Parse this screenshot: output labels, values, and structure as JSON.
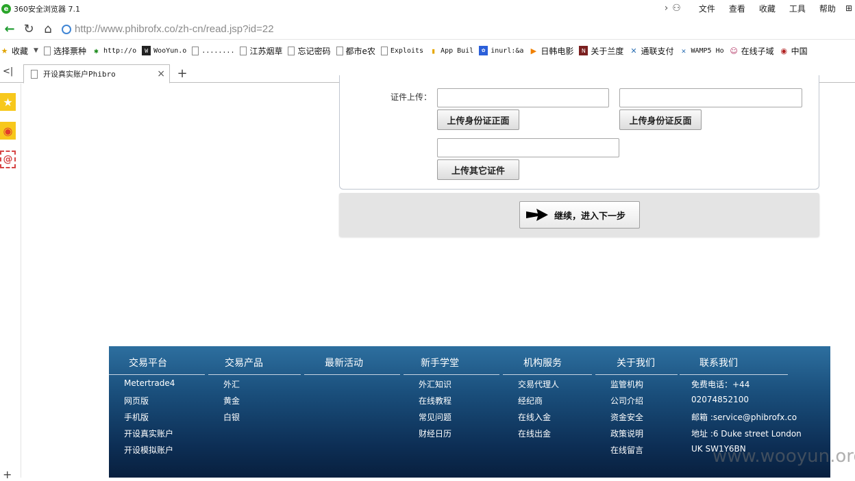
{
  "browser": {
    "app_title": "360安全浏览器 7.1",
    "menus": [
      "文件",
      "查看",
      "收藏",
      "工具",
      "帮助"
    ],
    "url": "http://www.phibrofx.co/zh-cn/read.jsp?id=22",
    "tab_title": "开设真实账户Phibro",
    "bookmarks": {
      "favorites": "收藏",
      "b1": "选择票种",
      "b2": "http://o",
      "b3": "WooYun.o",
      "b4": "........",
      "b5": "江苏烟草",
      "b6": "忘记密码",
      "b7": "都市e农",
      "b8": "Exploits",
      "b9": "App Buil",
      "b10": "inurl:&a",
      "b11": "日韩电影",
      "b12": "关于兰度",
      "b13": "通联支付",
      "b14": "WAMP5 Ho",
      "b15": "在线子域",
      "b16": "中国"
    }
  },
  "form": {
    "upload_label": "证件上传：",
    "btn_front": "上传身份证正面",
    "btn_back": "上传身份证反面",
    "btn_other": "上传其它证件",
    "next_label": "继续，进入下一步"
  },
  "footer": {
    "platform": {
      "title": "交易平台",
      "items": [
        "Metertrade4",
        "网页版",
        "手机版",
        "开设真实账户",
        "开设模拟账户"
      ]
    },
    "products": {
      "title": "交易产品",
      "items": [
        "外汇",
        "黄金",
        "白银"
      ]
    },
    "events": {
      "title": "最新活动"
    },
    "learn": {
      "title": "新手学堂",
      "items": [
        "外汇知识",
        "在线教程",
        "常见问题",
        "财经日历"
      ]
    },
    "institution": {
      "title": "机构服务",
      "items": [
        "交易代理人",
        "经纪商",
        "在线入金",
        "在线出金"
      ]
    },
    "about": {
      "title": "关于我们",
      "items": [
        "监管机构",
        "公司介绍",
        "资金安全",
        "政策说明",
        "在线留言"
      ]
    },
    "contact": {
      "title": "联系我们",
      "items": [
        "免费电话：+44",
        "02074852100",
        "邮箱 :service@phibrofx.co",
        "地址 :6 Duke street London",
        "UK SW1Y6BN"
      ]
    }
  },
  "watermark": "www.wooyun.org"
}
